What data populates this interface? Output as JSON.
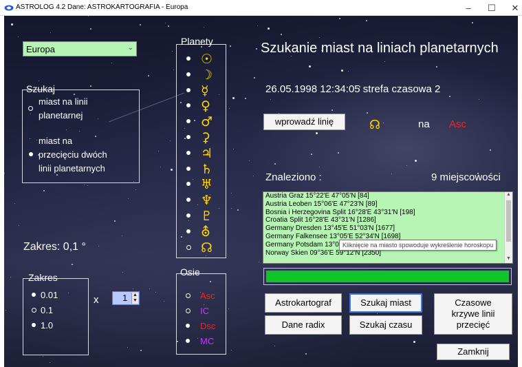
{
  "window": {
    "title": "ASTROLOG 4.2  Dane: ASTROKARTOGRAFIA - Europa",
    "minimize": "–",
    "maximize": "☐",
    "close": "✕"
  },
  "region_select": {
    "value": "Europa"
  },
  "search_group": {
    "legend": "Szukaj",
    "option1_line1": "miast na linii",
    "option1_line2": "planetarnej",
    "option2_line1": "miast na",
    "option2_line2": "przecięciu dwóch",
    "option2_line3": "linii planetarnych",
    "selected": 2
  },
  "range_text": "Zakres:  0,1 °",
  "range_group": {
    "legend": "Zakres",
    "options": [
      "0.01",
      "0.1",
      "1.0"
    ],
    "selected": [
      0,
      2
    ]
  },
  "multiplier": {
    "label": "x",
    "value": "1"
  },
  "planets_group": {
    "legend": "Planety",
    "symbols": [
      "☉",
      "☽",
      "☿",
      "♀",
      "♂",
      "⚳",
      "♃",
      "♄",
      "♅",
      "♆",
      "♇",
      "⛢",
      "☊"
    ],
    "selected_last": false
  },
  "axes_group": {
    "legend": "Osie",
    "items": [
      {
        "label": "Asc",
        "color": "#ff1f1f"
      },
      {
        "label": "IC",
        "color": "#c03cff"
      },
      {
        "label": "Dsc",
        "color": "#ff1f1f"
      },
      {
        "label": "MC",
        "color": "#c03cff"
      }
    ]
  },
  "heading": "Szukanie miast na liniach planetarnych",
  "datetime": "26.05.1998  12:34:05  strefa czasowa 2",
  "enter_line_button": "wprowadź linię",
  "line_node_symbol": "☊",
  "na_label": "na",
  "asc_label": "Asc",
  "found_label": "Znaleziono :",
  "found_count": "9 miejscowości",
  "results": [
    "Austria  Graz  15°22'E 47°05'N  [84]",
    "Austria  Leoben  15°06'E 47°23'N  [89]",
    "Bosnia i Herzegovina  Split  16°28'E 43°31'N  [198]",
    "Croatia  Split  16°28'E 43°31'N  [1286]",
    "Germany  Dresden  13°45'E 51°03'N  [1677]",
    "Germany  Falkensee  13°05'E 52°34'N  [1698]",
    "Germany  Potsdam  13°04'E 52°24'N  [1746]",
    "Norway  Skien  09°36'E 59°12'N  [2350]"
  ],
  "tooltip": "Kliknięcie na miasto spowoduje wykreślenie horoskopu",
  "progress": {
    "fraction": 1.0
  },
  "buttons": {
    "astrocartograph": "Astrokartograf",
    "search_cities": "Szukaj miast",
    "time_curves": "Czasowe krzywe linii przecięć",
    "radix_data": "Dane radix",
    "search_time": "Szukaj czasu",
    "close": "Zamknij"
  }
}
